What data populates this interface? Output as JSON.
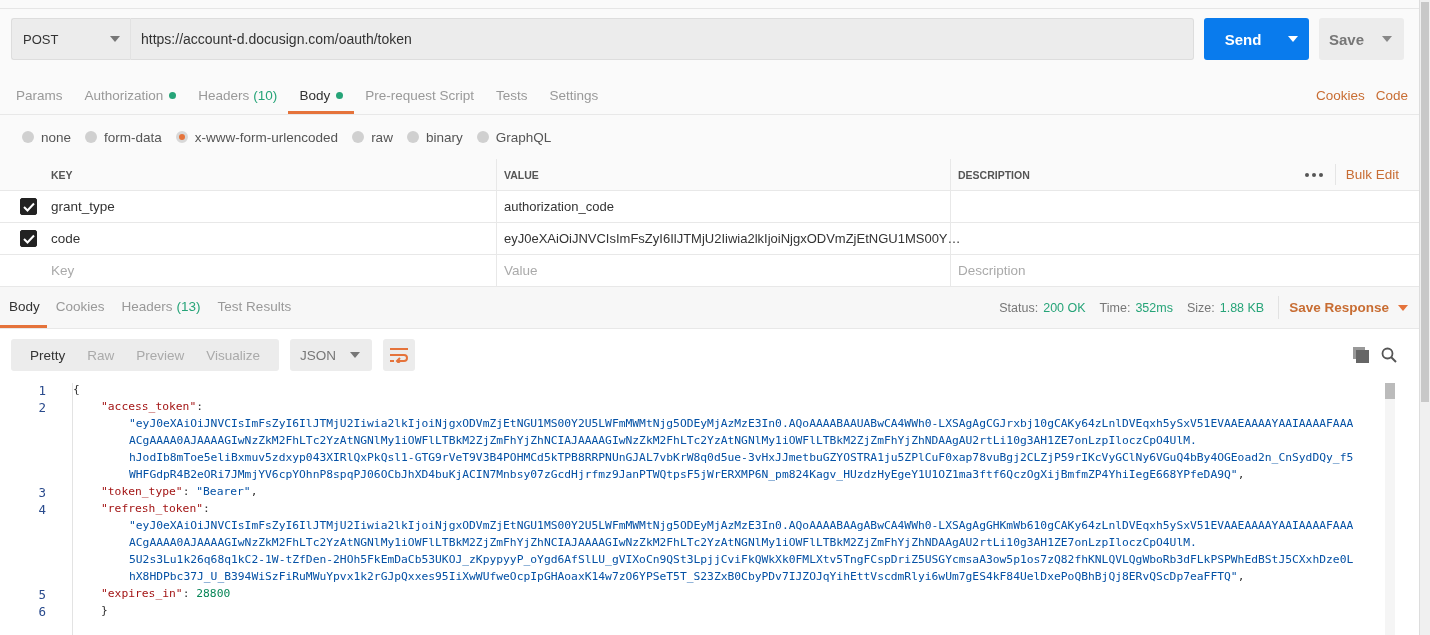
{
  "request": {
    "method": "POST",
    "url": "https://account-d.docusign.com/oauth/token",
    "send": "Send",
    "save": "Save"
  },
  "request_tabs": [
    {
      "label": "Params",
      "selected": false,
      "dot": false
    },
    {
      "label": "Authorization",
      "selected": false,
      "dot": true
    },
    {
      "label": "Headers",
      "count": "(10)",
      "selected": false,
      "dot": false
    },
    {
      "label": "Body",
      "selected": true,
      "dot": true
    },
    {
      "label": "Pre-request Script",
      "selected": false,
      "dot": false
    },
    {
      "label": "Tests",
      "selected": false,
      "dot": false
    },
    {
      "label": "Settings",
      "selected": false,
      "dot": false
    }
  ],
  "request_links": [
    "Cookies",
    "Code"
  ],
  "body_types": [
    {
      "label": "none",
      "selected": false
    },
    {
      "label": "form-data",
      "selected": false
    },
    {
      "label": "x-www-form-urlencoded",
      "selected": true
    },
    {
      "label": "raw",
      "selected": false
    },
    {
      "label": "binary",
      "selected": false
    },
    {
      "label": "GraphQL",
      "selected": false
    }
  ],
  "params_table": {
    "columns": [
      "KEY",
      "VALUE",
      "DESCRIPTION"
    ],
    "bulk_edit": "Bulk Edit",
    "rows": [
      {
        "checked": true,
        "key": "grant_type",
        "value": "authorization_code"
      },
      {
        "checked": true,
        "key": "code",
        "value": "eyJ0eXAiOiJNVCIsImFsZyI6IlJTMjU2Iiwia2lkIjoiNjgxODVmZjEtNGU1MS00Y…"
      }
    ],
    "new_row": {
      "key_placeholder": "Key",
      "value_placeholder": "Value",
      "description_placeholder": "Description"
    }
  },
  "response_tabs": [
    {
      "label": "Body",
      "selected": true
    },
    {
      "label": "Cookies",
      "selected": false
    },
    {
      "label": "Headers",
      "count": "(13)",
      "selected": false
    },
    {
      "label": "Test Results",
      "selected": false
    }
  ],
  "response_meta": [
    {
      "label": "Status:",
      "value": "200 OK"
    },
    {
      "label": "Time:",
      "value": "352ms"
    },
    {
      "label": "Size:",
      "value": "1.88 KB"
    }
  ],
  "save_response": "Save Response",
  "view_modes": [
    {
      "label": "Pretty",
      "selected": true
    },
    {
      "label": "Raw",
      "selected": false
    },
    {
      "label": "Preview",
      "selected": false
    },
    {
      "label": "Visualize",
      "selected": false
    }
  ],
  "format": "JSON",
  "code_lines": [
    {
      "number": "1",
      "tokens": [
        {
          "kind": "punct",
          "text": "{"
        }
      ]
    },
    {
      "number": "2",
      "tokens": [
        {
          "kind": "key",
          "text": "\"access_token\""
        },
        {
          "kind": "punct",
          "text": ":"
        }
      ],
      "wrapped": [
        "\"eyJ0eXAiOiJNVCIsImFsZyI6IlJTMjU2Iiwia2lkIjoiNjgxODVmZjEtNGU1MS00Y2U5LWFmMWMtNjg5ODEyMjAzMzE3In0.AQoAAAABAAUABwCA4WWh0-LXSAgAgCGJrxbj10gCAKy64zLnlDVEqxh5ySxV51EVAAEAAAAYAAIAAAAFAAA",
        "ACgAAAA0AJAAAAGIwNzZkM2FhLTc2YzAtNGNlMy1iOWFlLTBkM2ZjZmFhYjZhNCIAJAAAAGIwNzZkM2FhLTc2YzAtNGNlMy1iOWFlLTBkM2ZjZmFhYjZhNDAAgAU2rtLi10g3AH1ZE7onLzpIloczCpO4UlM.",
        "hJodIb8mToe5eliBxmuv5zdxyp043XIRlQxPkQsl1-GTG9rVeT9V3B4POHMCd5kTPB8RRPNUnGJAL7vbKrW8q0d5ue-3vHxJJmetbuGZYOSTRA1ju5ZPlCuF0xap78vuBgj2CLZjP59rIKcVyGClNy6VGuQ4bBy4OGEoad2n_CnSydDQy_f5",
        "WHFGdpR4B2eORi7JMmjYV6cpYOhnP8spqPJ06OCbJhXD4buKjACIN7Mnbsy07zGcdHjrfmz9JanPTWQtpsF5jWrERXMP6N_pm824Kagv_HUzdzHyEgeY1U1OZ1ma3ftf6QczOgXijBmfmZP4YhiIegE668YPfeDA9Q\""
      ],
      "trail": ","
    },
    {
      "number": "3",
      "tokens": [
        {
          "kind": "key",
          "text": "\"token_type\""
        },
        {
          "kind": "punct",
          "text": ": "
        },
        {
          "kind": "string",
          "text": "\"Bearer\""
        },
        {
          "kind": "punct",
          "text": ","
        }
      ]
    },
    {
      "number": "4",
      "tokens": [
        {
          "kind": "key",
          "text": "\"refresh_token\""
        },
        {
          "kind": "punct",
          "text": ":"
        }
      ],
      "wrapped": [
        "\"eyJ0eXAiOiJNVCIsImFsZyI6IlJTMjU2Iiwia2lkIjoiNjgxODVmZjEtNGU1MS00Y2U5LWFmMWMtNjg5ODEyMjAzMzE3In0.AQoAAAABAAgABwCA4WWh0-LXSAgAgGHKmWb610gCAKy64zLnlDVEqxh5ySxV51EVAAEAAAAYAAIAAAAFAAA",
        "ACgAAAA0AJAAAAGIwNzZkM2FhLTc2YzAtNGNlMy1iOWFlLTBkM2ZjZmFhYjZhNCIAJAAAAGIwNzZkM2FhLTc2YzAtNGNlMy1iOWFlLTBkM2ZjZmFhYjZhNDAAgAU2rtLi10g3AH1ZE7onLzpIloczCpO4UlM.",
        "5U2s3Lu1k26q68q1kC2-1W-tZfDen-2HOh5FkEmDaCb53UKOJ_zKpypyyP_oYgd6AfSlLU_gVIXoCn9QSt3LpjjCviFkQWkXk0FMLXtv5TngFCspDriZ5USGYcmsaA3ow5p1os7zQ82fhKNLQVLQgWboRb3dFLkPSPWhEdBStJ5CXxhDze0L",
        "hX8HDPbc37J_U_B394WiSzFiRuMWuYpvx1k2rGJpQxxes95IiXwWUfweOcpIpGHAoaxK14w7zO6YPSeT5T_S23ZxB0CbyPDv7IJZOJqYihEttVscdmRlyi6wUm7gES4kF84UelDxePoQBhBjQj8ERvQScDp7eaFFTQ\""
      ],
      "trail": ","
    },
    {
      "number": "5",
      "tokens": [
        {
          "kind": "key",
          "text": "\"expires_in\""
        },
        {
          "kind": "punct",
          "text": ": "
        },
        {
          "kind": "number",
          "text": "28800"
        }
      ]
    },
    {
      "number": "6",
      "tokens": [
        {
          "kind": "punct",
          "text": "}"
        }
      ]
    }
  ]
}
